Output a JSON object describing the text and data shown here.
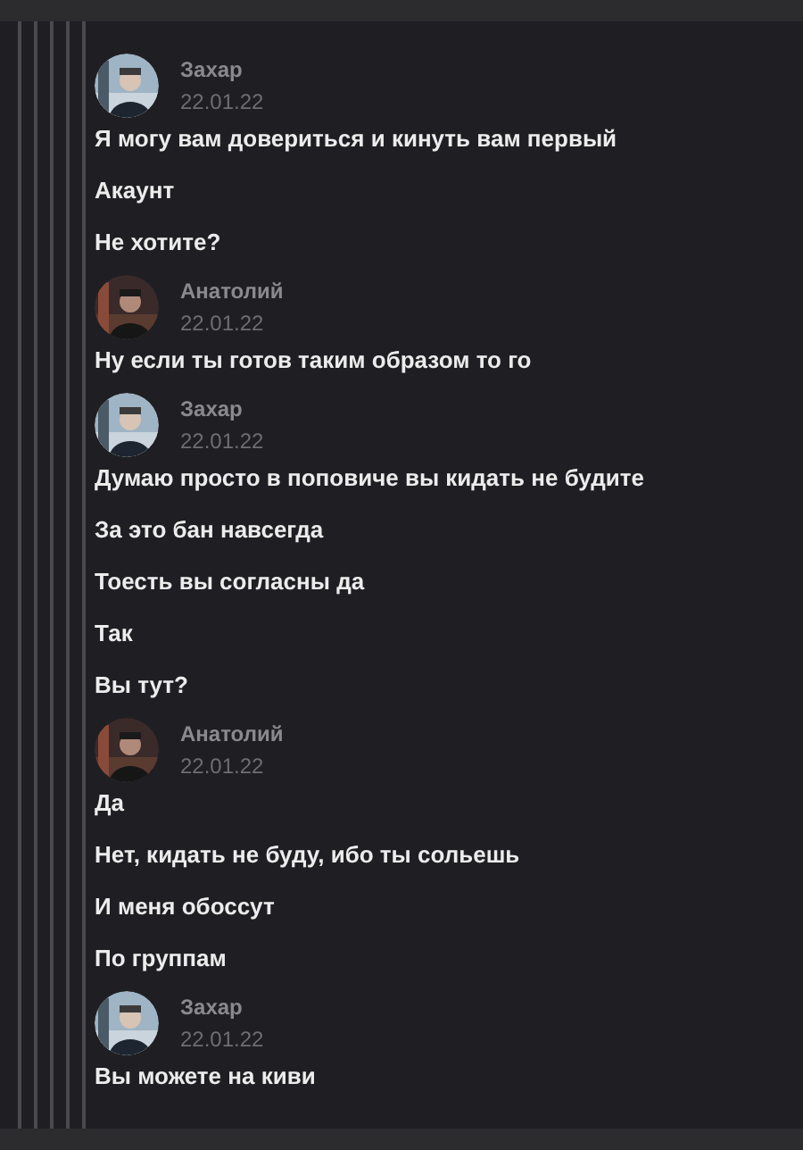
{
  "posts": [
    {
      "author": "Захар",
      "date": "22.01.22",
      "messages": [
        "Я могу вам довериться и кинуть вам первый",
        "Акаунт",
        "Не хотите?"
      ]
    },
    {
      "author": "Анатолий",
      "date": "22.01.22",
      "messages": [
        "Ну если ты готов таким образом то го"
      ]
    },
    {
      "author": "Захар",
      "date": "22.01.22",
      "messages": [
        "Думаю просто в поповиче вы кидать не будите",
        "За это бан навсегда",
        "Тоесть вы согласны да",
        "Так",
        "Вы тут?"
      ]
    },
    {
      "author": "Анатолий",
      "date": "22.01.22",
      "messages": [
        "Да",
        "Нет, кидать не буду, ибо ты сольешь",
        "И меня обоссут",
        "По группам"
      ]
    },
    {
      "author": "Захар",
      "date": "22.01.22",
      "messages": [
        "Вы можете на киви"
      ]
    }
  ]
}
